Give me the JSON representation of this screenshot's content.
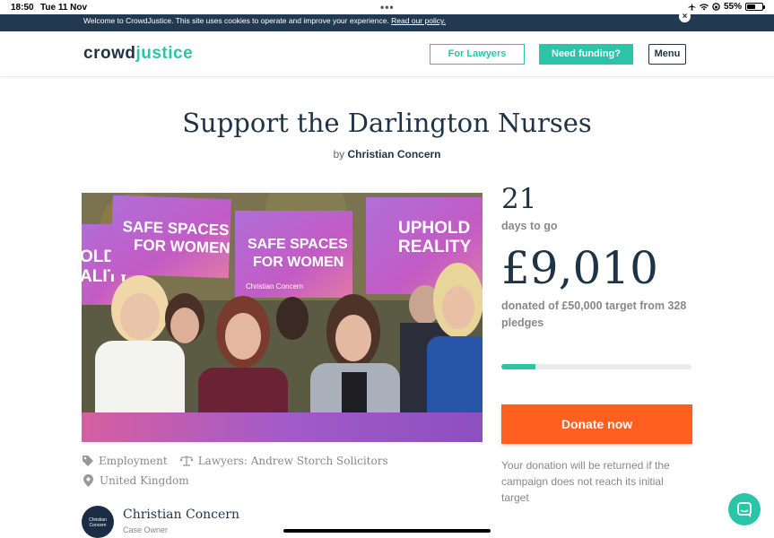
{
  "status_bar": {
    "time": "18:50",
    "date": "Tue 11 Nov",
    "battery": "55%",
    "battery_level": 0.55
  },
  "cookie_banner": {
    "message": "Welcome to CrowdJustice. This site uses cookies to operate and improve your experience. ",
    "link": "Read our policy."
  },
  "header": {
    "logo_part1": "crowd",
    "logo_part2": "justice",
    "for_lawyers": "For Lawyers",
    "need_funding": "Need funding?",
    "menu": "Menu"
  },
  "campaign": {
    "title": "Support the Darlington Nurses",
    "by_prefix": "by",
    "organiser": "Christian Concern",
    "category": "Employment",
    "lawyers": "Lawyers: Andrew Storch Solicitors",
    "location": "United Kingdom",
    "owner_name": "Christian Concern",
    "owner_role": "Case Owner",
    "image_signs": [
      "SAFE SPACES FOR WOMEN",
      "UPHOLD REALITY",
      "OLD ALITY"
    ]
  },
  "stats": {
    "days": "21",
    "days_label": "days to go",
    "amount": "£9,010",
    "pledge_text": "donated of £50,000 target from 328 pledges",
    "progress_fraction": 0.18
  },
  "donate_label": "Donate now",
  "refund_note": "Your donation will be returned if the campaign does not reach its initial target",
  "colors": {
    "teal": "#2bc4a8",
    "navy": "#1f3347",
    "orange": "#ff5f1f",
    "banner": "#223a51"
  }
}
